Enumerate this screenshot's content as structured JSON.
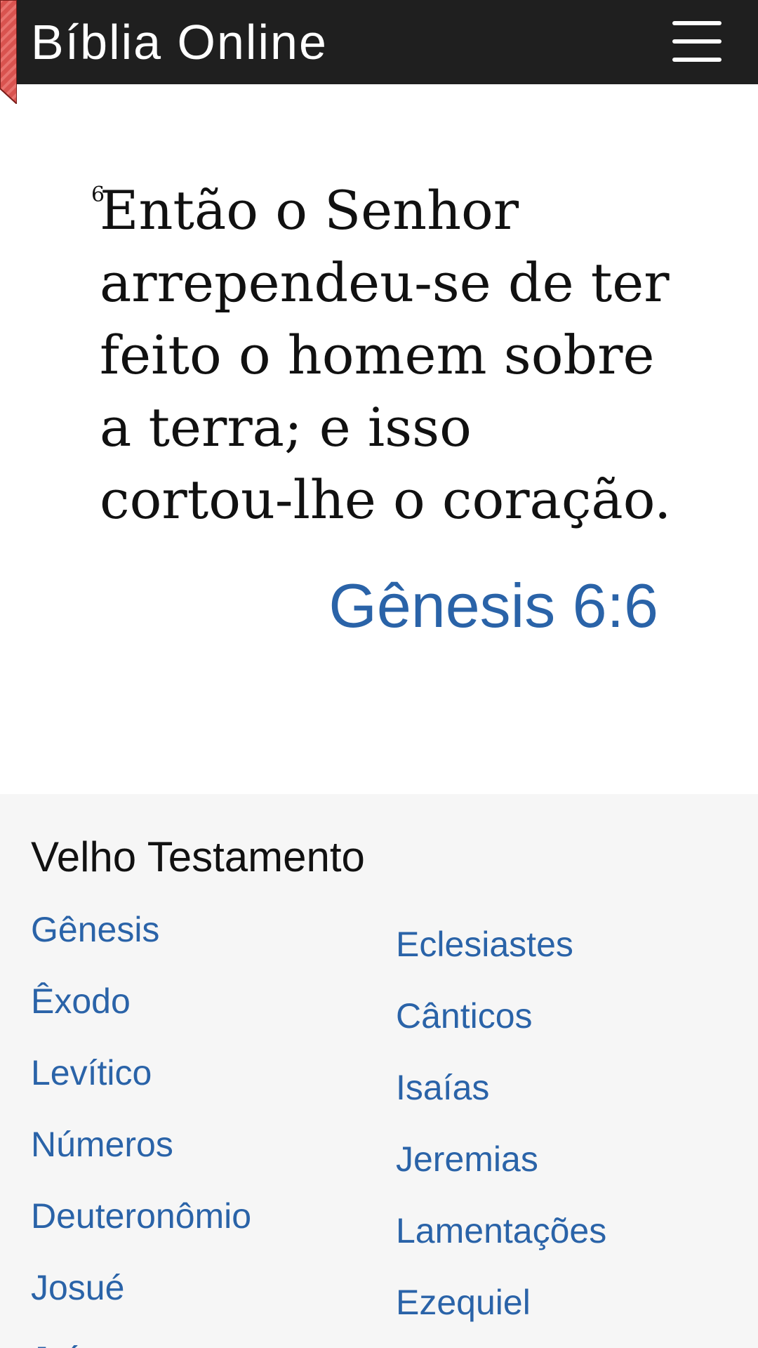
{
  "navbar": {
    "brand": "Bíblia Online"
  },
  "verse": {
    "number": "6",
    "text": "Então o Senhor arrependeu-se de ter feito o homem sobre a terra; e isso cortou-lhe o coração.",
    "reference": "Gênesis 6:6"
  },
  "books": {
    "title": "Velho Testamento",
    "left_column": [
      "Gênesis",
      "Êxodo",
      "Levítico",
      "Números",
      "Deuteronômio",
      "Josué",
      "Juízes"
    ],
    "right_column": [
      "Eclesiastes",
      "Cânticos",
      "Isaías",
      "Jeremias",
      "Lamentações",
      "Ezequiel"
    ]
  },
  "colors": {
    "navbar_bg": "#1f1f1f",
    "link": "#2a63a8",
    "ribbon": "#d9534f",
    "section_bg": "#f6f6f6"
  },
  "icons": {
    "menu": "hamburger-icon",
    "bookmark": "bookmark-ribbon-icon"
  }
}
